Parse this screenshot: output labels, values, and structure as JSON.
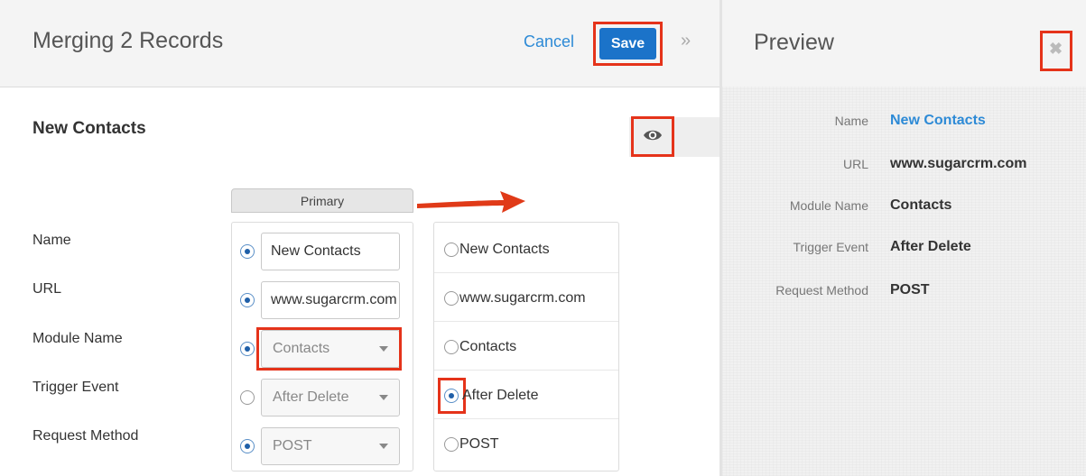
{
  "header": {
    "title": "Merging 2 Records",
    "cancel_label": "Cancel",
    "save_label": "Save",
    "collapse_glyph": "»"
  },
  "record": {
    "title": "New Contacts"
  },
  "merge": {
    "primary_label": "Primary",
    "fields": [
      {
        "label": "Name",
        "primary_value": "New Contacts",
        "primary_selected": true,
        "secondary_value": "New Contacts",
        "secondary_selected": false,
        "input_type": "text"
      },
      {
        "label": "URL",
        "primary_value": "www.sugarcrm.com",
        "primary_selected": true,
        "secondary_value": "www.sugarcrm.com",
        "secondary_selected": false,
        "input_type": "text"
      },
      {
        "label": "Module Name",
        "primary_value": "Contacts",
        "primary_selected": true,
        "secondary_value": "Contacts",
        "secondary_selected": false,
        "input_type": "select"
      },
      {
        "label": "Trigger Event",
        "primary_value": "After Delete",
        "primary_selected": false,
        "secondary_value": "After Delete",
        "secondary_selected": true,
        "input_type": "select"
      },
      {
        "label": "Request Method",
        "primary_value": "POST",
        "primary_selected": true,
        "secondary_value": "POST",
        "secondary_selected": false,
        "input_type": "select"
      }
    ]
  },
  "preview": {
    "title": "Preview",
    "close_glyph": "✖",
    "rows": [
      {
        "label": "Name",
        "value": "New Contacts"
      },
      {
        "label": "URL",
        "value": "www.sugarcrm.com"
      },
      {
        "label": "Module Name",
        "value": "Contacts"
      },
      {
        "label": "Trigger Event",
        "value": "After Delete"
      },
      {
        "label": "Request Method",
        "value": "POST"
      }
    ]
  },
  "colors": {
    "accent": "#1b73c9",
    "link": "#2d8ad6",
    "highlight": "#e5331a"
  }
}
